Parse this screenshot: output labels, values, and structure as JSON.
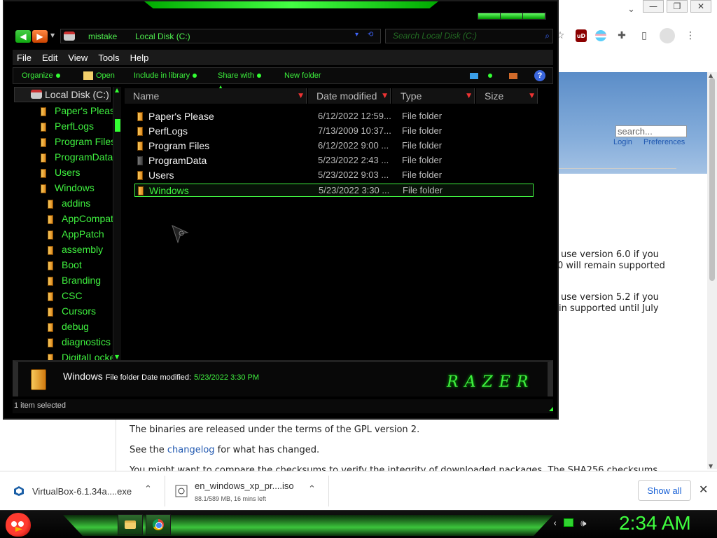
{
  "browser": {
    "window_controls": [
      "—",
      "❐",
      "✕"
    ],
    "tab_search_arrow": "⌄",
    "extensions": {
      "bookmark_star": "☆",
      "ublock": "uD",
      "puzzle": "✚",
      "side_panel": "▯",
      "menu": "⋮"
    }
  },
  "webpage": {
    "search_placeholder": "search...",
    "login_link": "Login",
    "preferences_link": "Preferences",
    "text_lines": [
      "use version 6.0 if you",
      "0 will remain supported",
      "use version 5.2 if you",
      "in supported until July"
    ],
    "gpl_line": "The binaries are released under the terms of the GPL version 2.",
    "changelog_prefix": "See the ",
    "changelog_link": "changelog",
    "changelog_suffix": " for what has changed.",
    "checksum_line": "You might want to compare the checksums to verify the integrity of downloaded packages. The SHA256 checksums"
  },
  "downloads": {
    "items": [
      {
        "name": "VirtualBox-6.1.34a....exe",
        "sub": ""
      },
      {
        "name": "en_windows_xp_pr....iso",
        "sub": "88.1/589 MB, 16 mins left"
      }
    ],
    "show_all": "Show all",
    "close": "✕"
  },
  "explorer": {
    "address": {
      "user": "mistake",
      "location": "Local Disk (C:)",
      "search_placeholder": "Search Local Disk (C:)"
    },
    "menu": [
      "File",
      "Edit",
      "View",
      "Tools",
      "Help"
    ],
    "commands": {
      "organize": "Organize",
      "open": "Open",
      "include": "Include in library",
      "share": "Share with",
      "new_folder": "New folder"
    },
    "nav_root": "Local Disk (C:)",
    "nav_items": [
      {
        "label": "Paper's Pleas",
        "level": 0
      },
      {
        "label": "PerfLogs",
        "level": 0
      },
      {
        "label": "Program Files",
        "level": 0
      },
      {
        "label": "ProgramData",
        "level": 0
      },
      {
        "label": "Users",
        "level": 0
      },
      {
        "label": "Windows",
        "level": 0
      },
      {
        "label": "addins",
        "level": 1
      },
      {
        "label": "AppCompat",
        "level": 1
      },
      {
        "label": "AppPatch",
        "level": 1
      },
      {
        "label": "assembly",
        "level": 1
      },
      {
        "label": "Boot",
        "level": 1
      },
      {
        "label": "Branding",
        "level": 1
      },
      {
        "label": "CSC",
        "level": 1
      },
      {
        "label": "Cursors",
        "level": 1
      },
      {
        "label": "debug",
        "level": 1
      },
      {
        "label": "diagnostics",
        "level": 1
      },
      {
        "label": "DigitalLocke",
        "level": 1
      }
    ],
    "columns": [
      "Name",
      "Date modified",
      "Type",
      "Size"
    ],
    "files": [
      {
        "name": "Paper's Please",
        "date": "6/12/2022 12:59...",
        "type": "File folder",
        "selected": false
      },
      {
        "name": "PerfLogs",
        "date": "7/13/2009 10:37...",
        "type": "File folder",
        "selected": false
      },
      {
        "name": "Program Files",
        "date": "6/12/2022 9:00 ...",
        "type": "File folder",
        "selected": false
      },
      {
        "name": "ProgramData",
        "date": "5/23/2022 2:43 ...",
        "type": "File folder",
        "selected": false
      },
      {
        "name": "Users",
        "date": "5/23/2022 9:03 ...",
        "type": "File folder",
        "selected": false
      },
      {
        "name": "Windows",
        "date": "5/23/2022 3:30 ...",
        "type": "File folder",
        "selected": true
      }
    ],
    "details": {
      "name": "Windows",
      "meta": "File folder Date modified:",
      "date": "5/23/2022 3:30 PM"
    },
    "brand": "RAZER",
    "status": "1 item selected"
  },
  "taskbar": {
    "clock": "2:34 AM"
  },
  "colors": {
    "accent_green": "#3ff03f",
    "explorer_bg": "#000000",
    "chrome_link": "#1a62d6"
  }
}
